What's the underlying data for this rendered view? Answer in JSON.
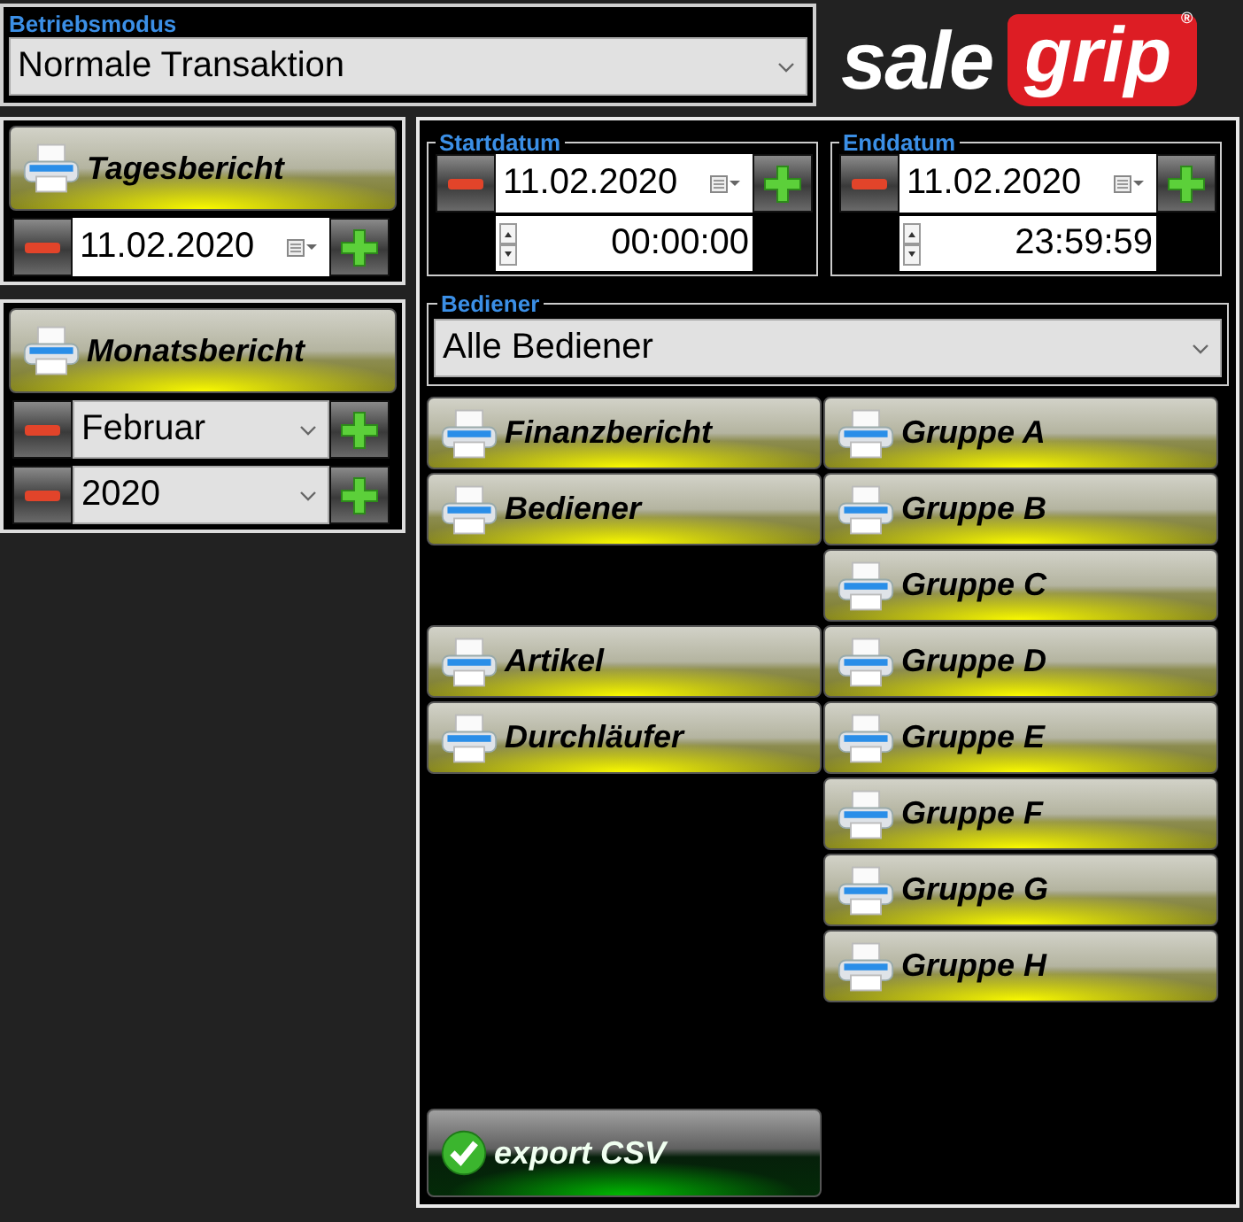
{
  "mode": {
    "label": "Betriebsmodus",
    "value": "Normale Transaktion"
  },
  "logo": {
    "word": "sale",
    "badge": "grip",
    "mark": "®"
  },
  "daily_report": {
    "button": "Tagesbericht",
    "date": "11.02.2020"
  },
  "monthly_report": {
    "button": "Monatsbericht",
    "month": "Februar",
    "year": "2020"
  },
  "range": [
    {
      "label": "Startdatum",
      "date": "11.02.2020",
      "time": "00:00:00"
    },
    {
      "label": "Enddatum",
      "date": "11.02.2020",
      "time": "23:59:59"
    }
  ],
  "operator": {
    "label": "Bediener",
    "value": "Alle Bediener"
  },
  "report_groups": [
    [
      "Finanzbericht",
      "Bediener"
    ],
    [
      "Artikel",
      "Durchläufer"
    ]
  ],
  "group_buttons": [
    "Gruppe A",
    "Gruppe B",
    "Gruppe C",
    "Gruppe D",
    "Gruppe E",
    "Gruppe F",
    "Gruppe G",
    "Gruppe H"
  ],
  "export_button": "export CSV"
}
